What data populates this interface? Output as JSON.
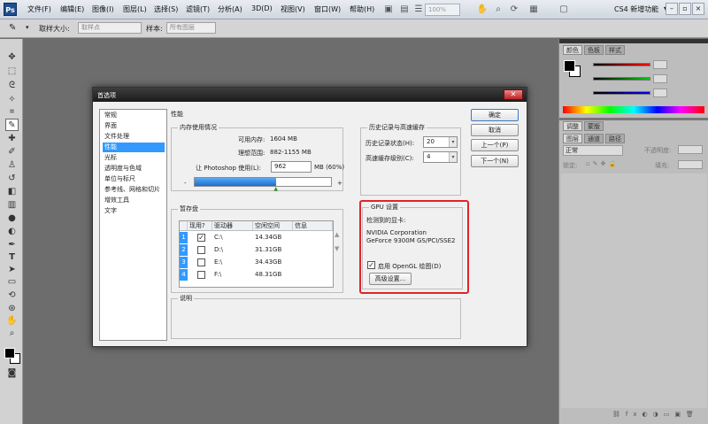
{
  "menubar": {
    "logo": "Ps",
    "items": [
      "文件(F)",
      "编辑(E)",
      "图像(I)",
      "图层(L)",
      "选择(S)",
      "滤镜(T)",
      "分析(A)",
      "3D(D)",
      "视图(V)",
      "窗口(W)",
      "帮助(H)"
    ],
    "zoom": "100%",
    "workspace": "CS4 新增功能",
    "workspace_arrow": "▾"
  },
  "options_bar": {
    "sample_size_label": "取样大小:",
    "sample_size_value": "取样点",
    "sample_label": "样本:",
    "sample_value": "所有图层"
  },
  "panels": {
    "color_tabs": [
      "颜色",
      "色板",
      "样式"
    ],
    "adjust_tabs": [
      "调整",
      "蒙版"
    ],
    "layer_tabs": [
      "图层",
      "通道",
      "路径"
    ],
    "blend_mode": "正常",
    "opacity_label": "不透明度:",
    "lock_label": "锁定:",
    "fill_label": "填充:"
  },
  "dialog": {
    "title": "首选项",
    "close_label": "✕",
    "nav_items": [
      "常规",
      "界面",
      "文件处理",
      "性能",
      "光标",
      "透明度与色域",
      "单位与标尺",
      "参考线、网格和切片",
      "增效工具",
      "文字"
    ],
    "selected_nav": 3,
    "section_title": "性能",
    "memory": {
      "group_title": "内存使用情况",
      "available_label": "可用内存:",
      "available_value": "1604 MB",
      "ideal_label": "理想范围:",
      "ideal_value": "882-1155 MB",
      "let_label": "让 Photoshop 使用(L):",
      "let_value": "962",
      "percent_label": "MB (60%)",
      "minus": "-",
      "plus": "+",
      "usage_fraction": 0.6
    },
    "history": {
      "group_title": "历史记录与高速缓存",
      "states_label": "历史记录状态(H):",
      "states_value": "20",
      "cache_label": "高速缓存级别(C):",
      "cache_value": "4"
    },
    "scratch": {
      "group_title": "暂存盘",
      "columns": [
        "现用?",
        "驱动器",
        "空闲空间",
        "信息"
      ],
      "rows": [
        {
          "num": "1",
          "active": "✓",
          "drive": "C:\\",
          "free": "14.34GB",
          "info": ""
        },
        {
          "num": "2",
          "active": "",
          "drive": "D:\\",
          "free": "31.31GB",
          "info": ""
        },
        {
          "num": "3",
          "active": "",
          "drive": "E:\\",
          "free": "34.43GB",
          "info": ""
        },
        {
          "num": "4",
          "active": "",
          "drive": "F:\\",
          "free": "48.31GB",
          "info": ""
        }
      ]
    },
    "gpu": {
      "group_title": "GPU 设置",
      "detected_label": "检测到的显卡:",
      "card_line1": "NVIDIA Corporation",
      "card_line2": "GeForce 9300M GS/PCI/SSE2",
      "opengl_check": "✓",
      "opengl_label": "启用 OpenGL 绘图(D)",
      "advanced_button": "高级设置..."
    },
    "description_title": "说明",
    "buttons": {
      "ok": "确定",
      "cancel": "取消",
      "prev": "上一个(P)",
      "next": "下一个(N)"
    }
  },
  "colors": {
    "highlight": "#3399ff",
    "annotation_red": "#e2232a"
  }
}
